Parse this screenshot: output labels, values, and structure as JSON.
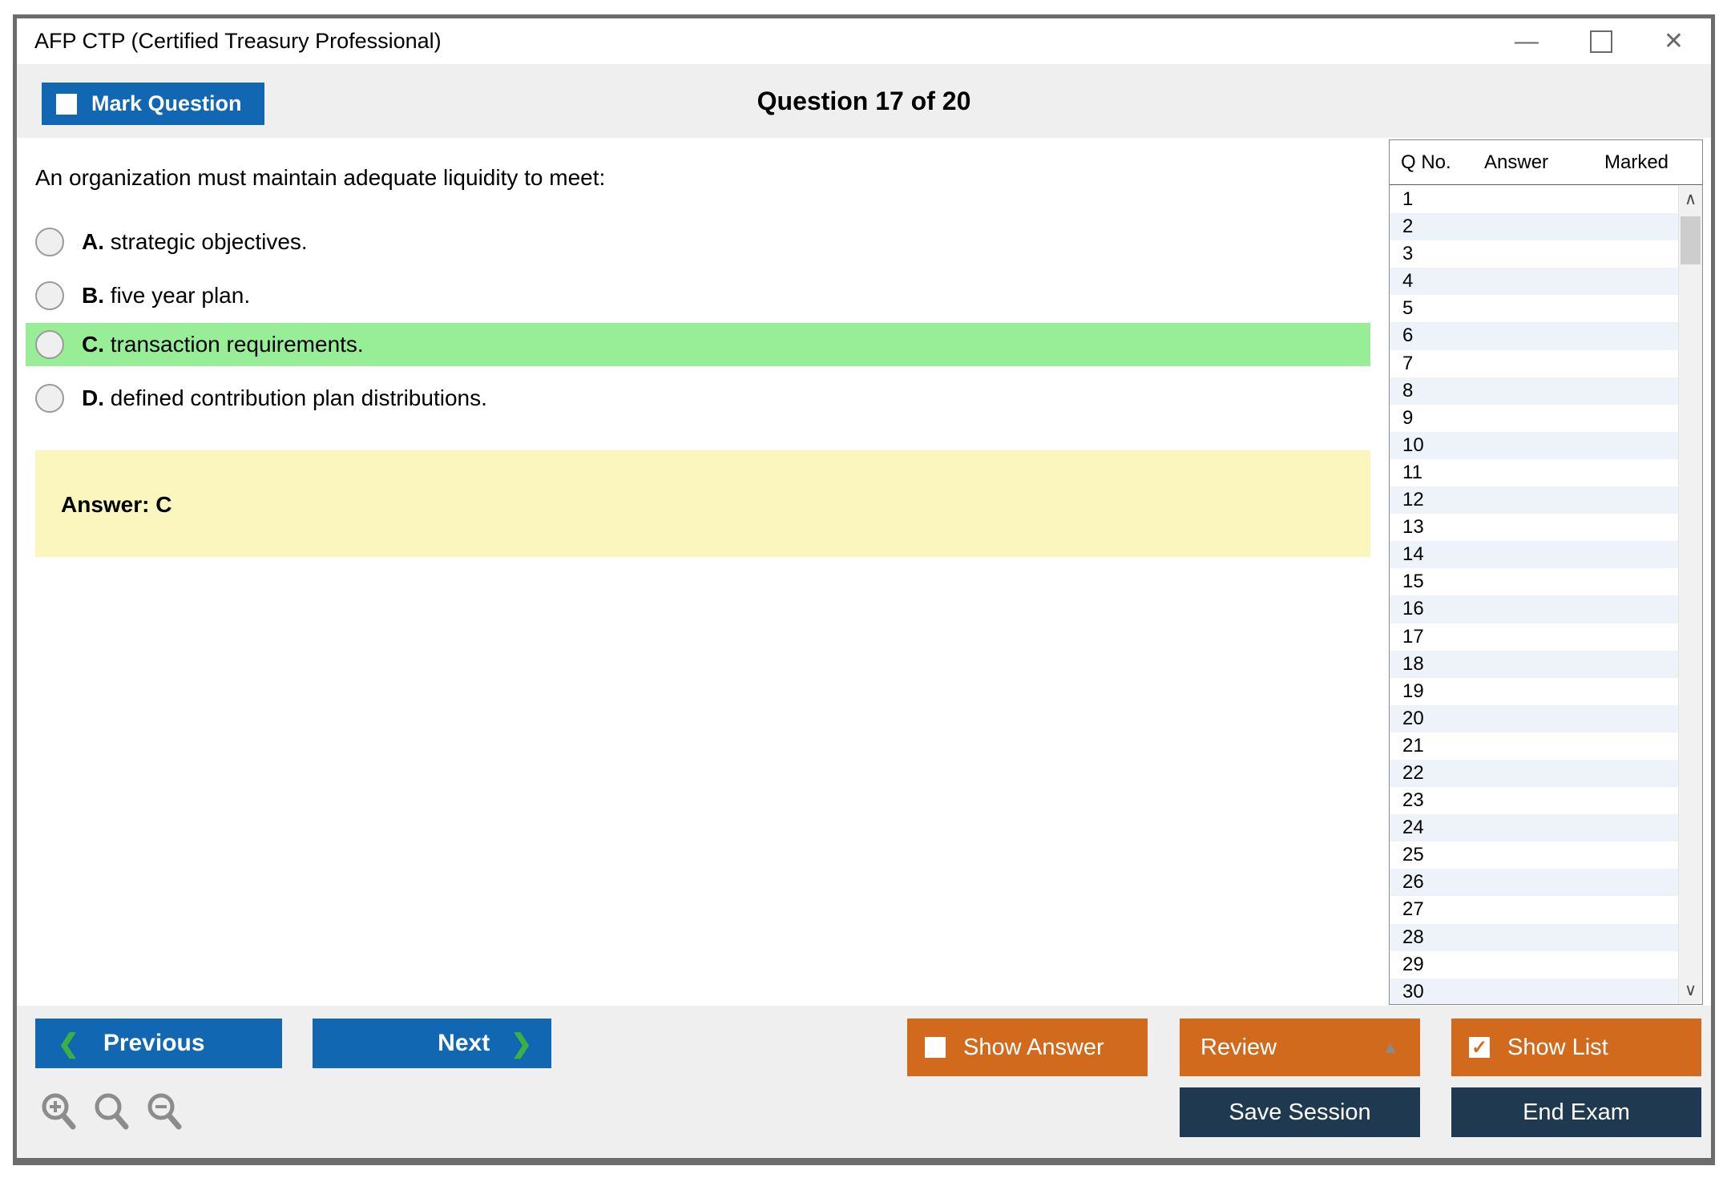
{
  "window": {
    "title": "AFP CTP (Certified Treasury Professional)"
  },
  "header": {
    "mark_question_label": "Mark Question",
    "question_counter": "Question 17 of 20"
  },
  "question": {
    "text": "An organization must maintain adequate liquidity to meet:",
    "options": [
      {
        "letter": "A.",
        "text": "strategic objectives.",
        "highlighted": false,
        "selected": false
      },
      {
        "letter": "B.",
        "text": "five year plan.",
        "highlighted": false,
        "selected": false
      },
      {
        "letter": "C.",
        "text": "transaction requirements.",
        "highlighted": true,
        "selected": false
      },
      {
        "letter": "D.",
        "text": "defined contribution plan distributions.",
        "highlighted": false,
        "selected": false
      }
    ],
    "answer_label": "Answer: C",
    "highlight_color": "#97ee97",
    "answer_box_color": "#faf6be"
  },
  "question_list": {
    "columns": [
      "Q No.",
      "Answer",
      "Marked"
    ],
    "rows": [
      {
        "q": "1",
        "answer": "",
        "marked": ""
      },
      {
        "q": "2",
        "answer": "",
        "marked": ""
      },
      {
        "q": "3",
        "answer": "",
        "marked": ""
      },
      {
        "q": "4",
        "answer": "",
        "marked": ""
      },
      {
        "q": "5",
        "answer": "",
        "marked": ""
      },
      {
        "q": "6",
        "answer": "",
        "marked": ""
      },
      {
        "q": "7",
        "answer": "",
        "marked": ""
      },
      {
        "q": "8",
        "answer": "",
        "marked": ""
      },
      {
        "q": "9",
        "answer": "",
        "marked": ""
      },
      {
        "q": "10",
        "answer": "",
        "marked": ""
      },
      {
        "q": "11",
        "answer": "",
        "marked": ""
      },
      {
        "q": "12",
        "answer": "",
        "marked": ""
      },
      {
        "q": "13",
        "answer": "",
        "marked": ""
      },
      {
        "q": "14",
        "answer": "",
        "marked": ""
      },
      {
        "q": "15",
        "answer": "",
        "marked": ""
      },
      {
        "q": "16",
        "answer": "",
        "marked": ""
      },
      {
        "q": "17",
        "answer": "",
        "marked": ""
      },
      {
        "q": "18",
        "answer": "",
        "marked": ""
      },
      {
        "q": "19",
        "answer": "",
        "marked": ""
      },
      {
        "q": "20",
        "answer": "",
        "marked": ""
      },
      {
        "q": "21",
        "answer": "",
        "marked": ""
      },
      {
        "q": "22",
        "answer": "",
        "marked": ""
      },
      {
        "q": "23",
        "answer": "",
        "marked": ""
      },
      {
        "q": "24",
        "answer": "",
        "marked": ""
      },
      {
        "q": "25",
        "answer": "",
        "marked": ""
      },
      {
        "q": "26",
        "answer": "",
        "marked": ""
      },
      {
        "q": "27",
        "answer": "",
        "marked": ""
      },
      {
        "q": "28",
        "answer": "",
        "marked": ""
      },
      {
        "q": "29",
        "answer": "",
        "marked": ""
      },
      {
        "q": "30",
        "answer": "",
        "marked": ""
      }
    ],
    "row_alt_color": "#edf3f9"
  },
  "footer": {
    "previous_label": "Previous",
    "next_label": "Next",
    "show_answer_label": "Show Answer",
    "review_label": "Review",
    "show_list_label": "Show List",
    "save_session_label": "Save Session",
    "end_exam_label": "End Exam",
    "show_list_checked": true,
    "show_answer_checked": false
  },
  "icons": {
    "chevron_left": "❮",
    "chevron_right": "❯",
    "caret_up": "▲",
    "check": "✓",
    "minimize": "—",
    "close": "✕",
    "scroll_up": "∧",
    "scroll_down": "∨"
  },
  "colors": {
    "button_blue": "#1167b1",
    "button_orange": "#d26a1e",
    "button_navy": "#1f3a50",
    "band_gray": "#f0efef",
    "chevron_green": "#3cb043"
  }
}
